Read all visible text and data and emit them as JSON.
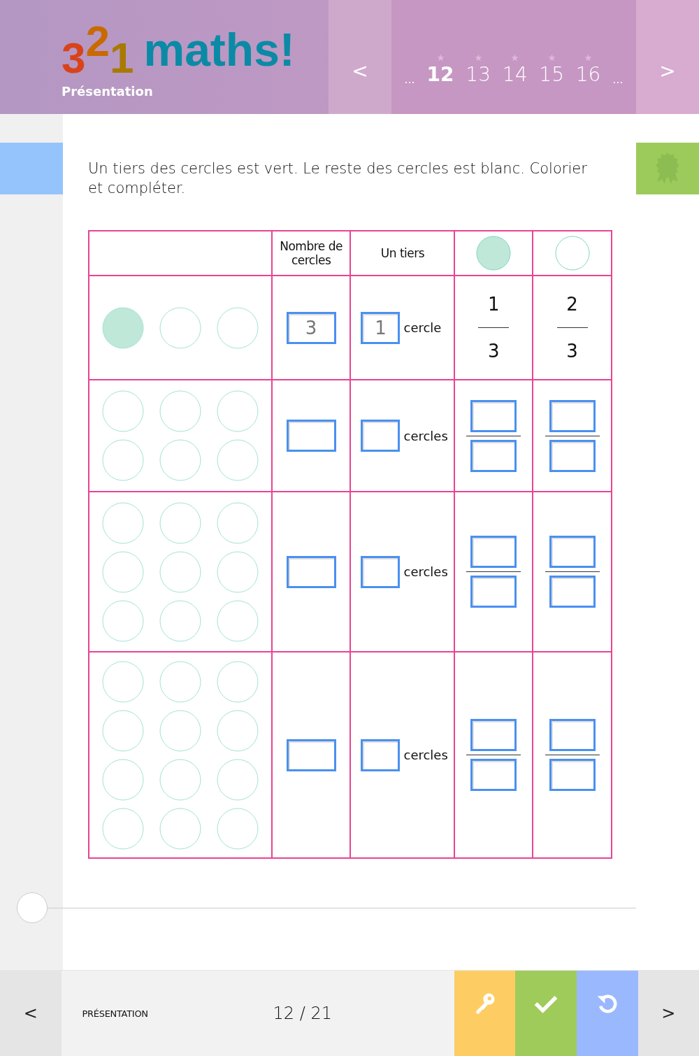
{
  "header": {
    "logo_digits": [
      "3",
      "2",
      "1"
    ],
    "logo_word": "maths!",
    "subtitle": "Présentation",
    "prev": "<",
    "next": ">",
    "ellipsis_before": "...",
    "ellipsis_after": "...",
    "pages": [
      {
        "label": "12",
        "selected": true
      },
      {
        "label": "13",
        "selected": false
      },
      {
        "label": "14",
        "selected": false
      },
      {
        "label": "15",
        "selected": false
      },
      {
        "label": "16",
        "selected": false
      }
    ]
  },
  "question": "Un tiers des cercles est vert. Le reste des cercles est blanc. Colorier et compléter.",
  "table": {
    "columns": [
      {
        "kind": "empty"
      },
      {
        "kind": "text",
        "label": "Nombre de cercles"
      },
      {
        "kind": "text",
        "label": "Un tiers"
      },
      {
        "kind": "circle",
        "filled": true
      },
      {
        "kind": "circle",
        "filled": false
      }
    ],
    "rows": [
      {
        "circles": [
          {
            "filled": true
          },
          {
            "filled": false
          },
          {
            "filled": false
          }
        ],
        "count_field": {
          "value": "3"
        },
        "third_field": {
          "value": "1"
        },
        "unit": "cercle",
        "fractions": [
          {
            "kind": "text",
            "numerator": "1",
            "denominator": "3"
          },
          {
            "kind": "text",
            "numerator": "2",
            "denominator": "3"
          }
        ]
      },
      {
        "circles": [
          {
            "filled": false
          },
          {
            "filled": false
          },
          {
            "filled": false
          },
          {
            "filled": false
          },
          {
            "filled": false
          },
          {
            "filled": false
          }
        ],
        "count_field": {},
        "third_field": {},
        "unit": "cercles",
        "fractions": [
          {
            "kind": "input"
          },
          {
            "kind": "input"
          }
        ]
      },
      {
        "circles": [
          {
            "filled": false
          },
          {
            "filled": false
          },
          {
            "filled": false
          },
          {
            "filled": false
          },
          {
            "filled": false
          },
          {
            "filled": false
          },
          {
            "filled": false
          },
          {
            "filled": false
          },
          {
            "filled": false
          }
        ],
        "count_field": {},
        "third_field": {},
        "unit": "cercles",
        "fractions": [
          {
            "kind": "input"
          },
          {
            "kind": "input"
          }
        ]
      },
      {
        "circles": [
          {
            "filled": false
          },
          {
            "filled": false
          },
          {
            "filled": false
          },
          {
            "filled": false
          },
          {
            "filled": false
          },
          {
            "filled": false
          },
          {
            "filled": false
          },
          {
            "filled": false
          },
          {
            "filled": false
          },
          {
            "filled": false
          },
          {
            "filled": false
          },
          {
            "filled": false
          }
        ],
        "count_field": {},
        "third_field": {},
        "unit": "cercles",
        "fractions": [
          {
            "kind": "input"
          },
          {
            "kind": "input"
          }
        ]
      }
    ]
  },
  "footer": {
    "prev": "<",
    "section": "PRÉSENTATION",
    "page": "12 / 21",
    "next": ">"
  }
}
